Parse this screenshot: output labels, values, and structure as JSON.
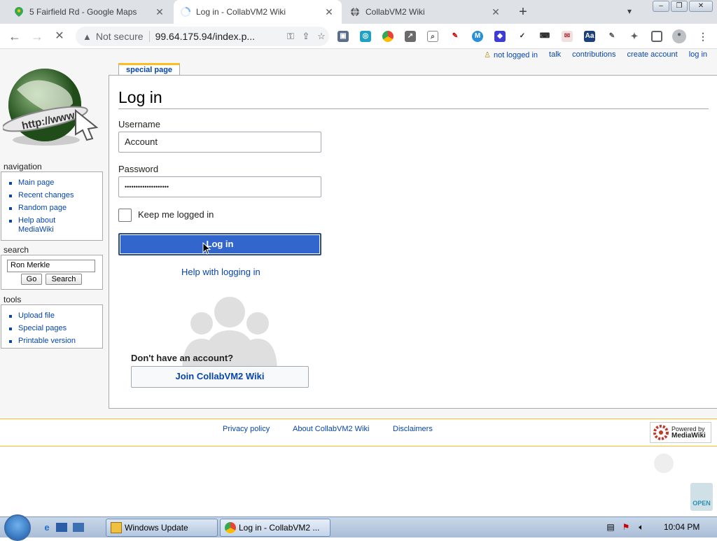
{
  "browser": {
    "tabs": [
      {
        "title": "5 Fairfield Rd - Google Maps",
        "icon": "maps-pin-icon"
      },
      {
        "title": "Log in - CollabVM2 Wiki",
        "icon": "loading-spinner-icon"
      },
      {
        "title": "CollabVM2 Wiki",
        "icon": "globe-icon"
      }
    ],
    "new_tab": "+",
    "close": "✕",
    "security_label": "Not secure",
    "url": "99.64.175.94/index.p..."
  },
  "wiki": {
    "personal_tools": [
      "not logged in",
      "talk",
      "contributions",
      "create account",
      "log in"
    ],
    "content_tab": "special page",
    "page_title": "Log in",
    "username_label": "Username",
    "username_value": "Account",
    "password_label": "Password",
    "password_value": "••••••••••••••••••••",
    "keep_logged_in": "Keep me logged in",
    "login_button": "Log in",
    "help_link": "Help with logging in",
    "no_account": "Don't have an account?",
    "join_button": "Join CollabVM2 Wiki",
    "navigation": {
      "heading": "navigation",
      "items": [
        "Main page",
        "Recent changes",
        "Random page",
        "Help about",
        "MediaWiki"
      ]
    },
    "search": {
      "heading": "search",
      "value": "Ron Merkle",
      "go": "Go",
      "search": "Search"
    },
    "tools": {
      "heading": "tools",
      "items": [
        "Upload file",
        "Special pages",
        "Printable version"
      ]
    },
    "footer": [
      "Privacy policy",
      "About CollabVM2 Wiki",
      "Disclaimers"
    ],
    "powered_by": "Powered by",
    "powered_name": "MediaWiki"
  },
  "taskbar": {
    "windows_update": "Windows Update",
    "chrome_window": "Log in - CollabVM2 ...",
    "clock": "10:04 PM"
  }
}
